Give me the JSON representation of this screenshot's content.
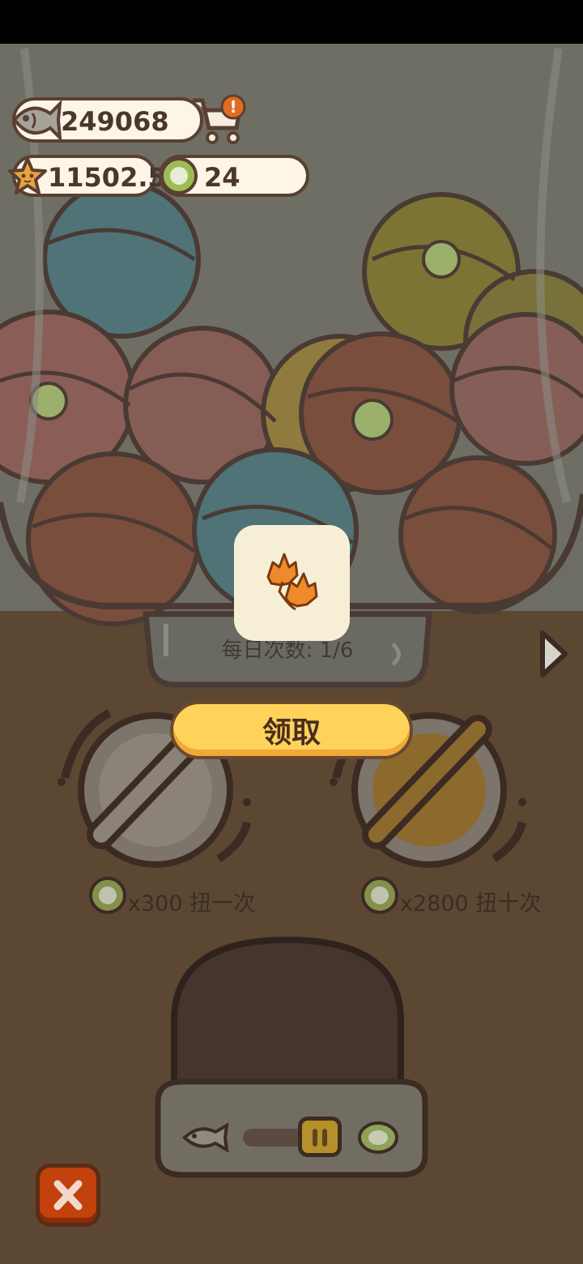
{
  "currencies": {
    "fish": {
      "value": "249068",
      "icon": "fish-icon"
    },
    "stars": {
      "value": "11502.5",
      "icon": "star-icon"
    },
    "gems": {
      "value": "24",
      "icon": "green-coin-icon"
    }
  },
  "shop": {
    "icon": "shopping-cart-icon",
    "badge": "!"
  },
  "machine": {
    "daily_count": "每日次数: 1/6",
    "reward_icon": "maple-leaves-icon",
    "claim_label": "领取"
  },
  "spins": {
    "single": {
      "cost": "x300 扭一次",
      "icon": "green-coin-icon"
    },
    "ten": {
      "cost": "x2800 扭十次",
      "icon": "green-coin-icon"
    }
  },
  "dispenser": {
    "slider_left_icon": "fish-icon",
    "slider_right_icon": "green-coin-icon"
  },
  "colors": {
    "background": "#5c4733",
    "claim_button": "#ffd35a",
    "close_button": "#c2410c",
    "pill": "#fcf5e8"
  }
}
